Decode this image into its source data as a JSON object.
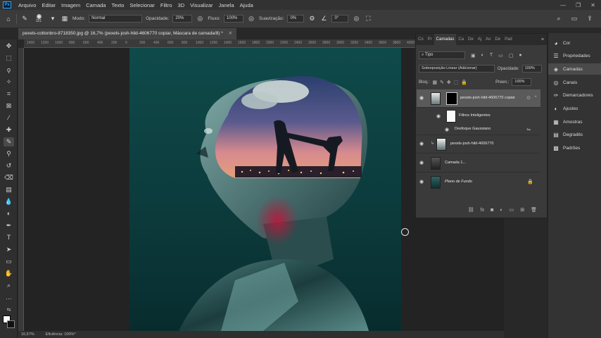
{
  "menubar": {
    "logo": "Ps",
    "items": [
      "Arquivo",
      "Editar",
      "Imagem",
      "Camada",
      "Texto",
      "Selecionar",
      "Filtro",
      "3D",
      "Visualizar",
      "Janela",
      "Ajuda"
    ],
    "window_controls": [
      "—",
      "❐",
      "✕"
    ]
  },
  "options_bar": {
    "brush_size": "321",
    "mode_label": "Modo:",
    "mode_value": "Normal",
    "opacity_label": "Opacidade:",
    "opacity_value": "20%",
    "flow_label": "Fluxo:",
    "flow_value": "100%",
    "smoothing_label": "Suavização:",
    "smoothing_value": "0%",
    "angle_value": "0°"
  },
  "document": {
    "tab_title": "pexels-cottonbro-8718350.jpg @ 16,7% (pexels-josh-hild-4606770 copiar, Máscara de camada/8) *",
    "zoom": "16,67%",
    "efficiency": "Eficiência: 100%*",
    "ruler_ticks": [
      "1400",
      "1200",
      "1000",
      "800",
      "600",
      "400",
      "200",
      "0",
      "200",
      "400",
      "600",
      "800",
      "1000",
      "1200",
      "1400",
      "1600",
      "1800",
      "2000",
      "2200",
      "2400",
      "2600",
      "2800",
      "3000",
      "3200",
      "3400",
      "3600",
      "3800",
      "4000"
    ]
  },
  "layers_panel": {
    "tabs": [
      "Co",
      "Pr",
      "Camadas",
      "Ca",
      "De",
      "Aj",
      "Ao",
      "De",
      "Pad"
    ],
    "active_tab": "Camadas",
    "kind_filter": "Tipo",
    "blend_mode": "Sobreposição Linear (Adicionar)",
    "opacity_label": "Opacidade:",
    "opacity_value": "100%",
    "lock_label": "Bloq.:",
    "fill_label": "Preen.:",
    "fill_value": "100%",
    "layers": [
      {
        "name": "pexels-josh-hild-4606770 copiar"
      },
      {
        "name": "Filtros Inteligentes"
      },
      {
        "name": "Desfoque Gaussiano"
      },
      {
        "name": "pexels-josh-hild-4606770"
      },
      {
        "name": "Camada 1..."
      },
      {
        "name": "Plano de Fundo"
      }
    ]
  },
  "dock": {
    "items": [
      "Cor",
      "Propriedades",
      "Camadas",
      "Canais",
      "Demarcadores",
      "Ajustes",
      "Amostras",
      "Degradês",
      "Padrões"
    ]
  }
}
